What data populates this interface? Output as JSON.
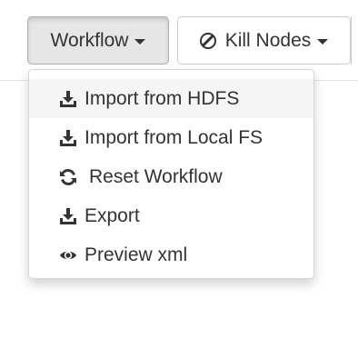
{
  "toolbar": {
    "workflow_label": "Workflow",
    "kill_nodes_label": "Kill Nodes"
  },
  "menu": {
    "items": [
      {
        "label": "Import from HDFS",
        "icon": "download-icon"
      },
      {
        "label": "Import from Local FS",
        "icon": "download-icon"
      },
      {
        "label": "Reset Workflow",
        "icon": "refresh-icon"
      },
      {
        "label": "Export",
        "icon": "download-icon"
      },
      {
        "label": "Preview xml",
        "icon": "eye-icon"
      }
    ]
  },
  "colors": {
    "active_button_bg": "#e6e6e6",
    "hover_item_bg": "#f5f5f5",
    "text": "#333333",
    "border": "#cccccc"
  }
}
